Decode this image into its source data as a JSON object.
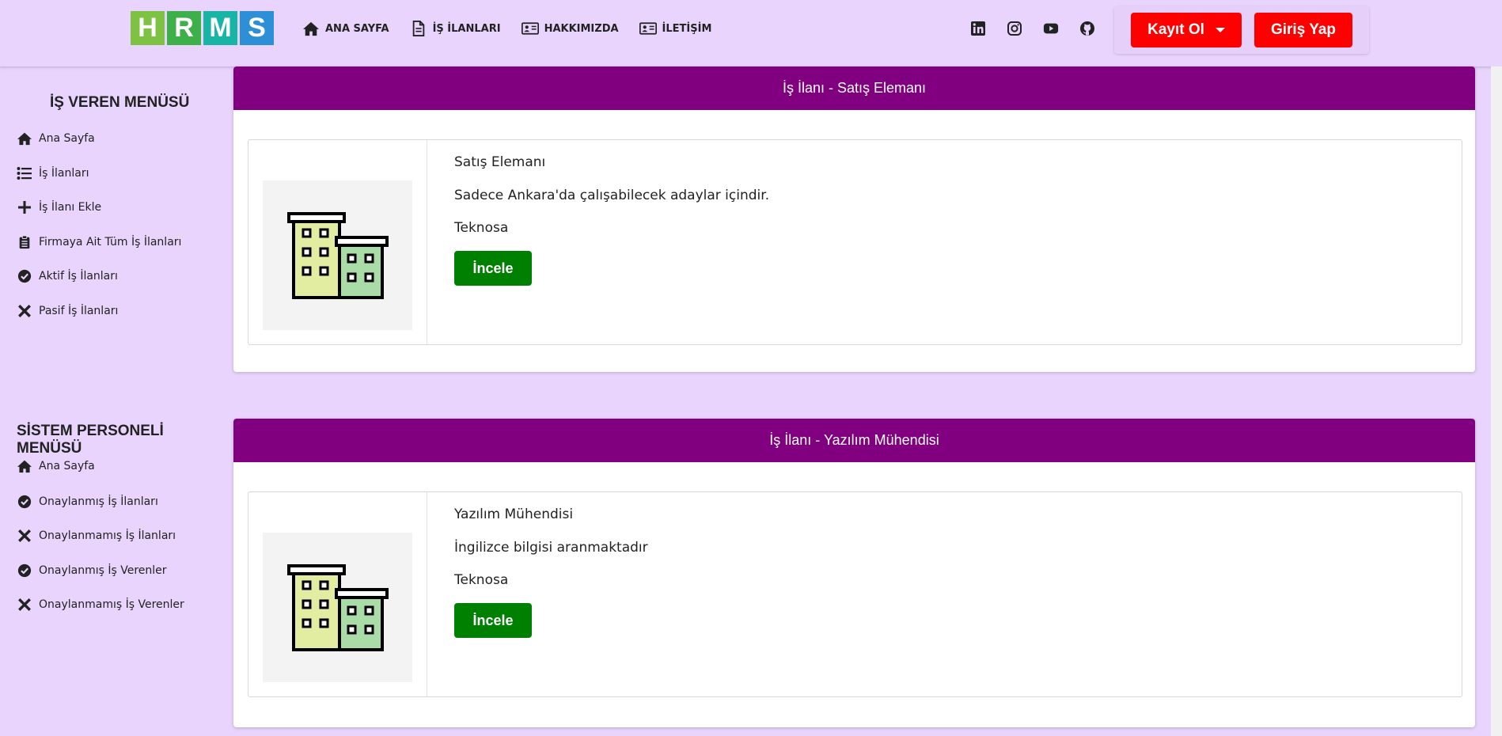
{
  "logo": {
    "letters": [
      "H",
      "R",
      "M",
      "S"
    ],
    "colors": [
      "#7dc242",
      "#3eb049",
      "#18b4a6",
      "#2d8fd5"
    ]
  },
  "nav": [
    {
      "label": "ANA SAYFA",
      "icon": "home-icon"
    },
    {
      "label": "İŞ İLANLARI",
      "icon": "document-icon"
    },
    {
      "label": "HAKKIMIZDA",
      "icon": "id-card-icon"
    },
    {
      "label": "İLETİŞİM",
      "icon": "id-card-icon"
    }
  ],
  "social": [
    "linkedin-icon",
    "instagram-icon",
    "youtube-icon",
    "github-icon"
  ],
  "auth": {
    "register_label": "Kayıt Ol",
    "login_label": "Giriş Yap"
  },
  "employer_menu": {
    "title": "İŞ VEREN MENÜSÜ",
    "items": [
      {
        "label": "Ana Sayfa",
        "icon": "home-icon"
      },
      {
        "label": "İş İlanları",
        "icon": "list-icon"
      },
      {
        "label": "İş İlanı Ekle",
        "icon": "plus-icon"
      },
      {
        "label": "Firmaya Ait Tüm İş İlanları",
        "icon": "clipboard-icon"
      },
      {
        "label": "Aktif İş İlanları",
        "icon": "check-circle-icon"
      },
      {
        "label": "Pasif İş İlanları",
        "icon": "x-icon"
      }
    ]
  },
  "staff_menu": {
    "title": "SİSTEM PERSONELİ MENÜSÜ",
    "items": [
      {
        "label": "Ana Sayfa",
        "icon": "home-icon"
      },
      {
        "label": "Onaylanmış İş İlanları",
        "icon": "check-circle-icon"
      },
      {
        "label": "Onaylanmamış İş İlanları",
        "icon": "x-icon"
      },
      {
        "label": "Onaylanmış İş Verenler",
        "icon": "check-circle-icon"
      },
      {
        "label": "Onaylanmamış İş Verenler",
        "icon": "x-icon"
      }
    ]
  },
  "jobs": [
    {
      "header": "İş İlanı - Satış Elemanı",
      "title": "Satış Elemanı",
      "description": "Sadece Ankara'da çalışabilecek adaylar içindir.",
      "company": "Teknosa",
      "button": "İncele"
    },
    {
      "header": "İş İlanı - Yazılım Mühendisi",
      "title": "Yazılım Mühendisi",
      "description": "İngilizce bilgisi aranmaktadır",
      "company": "Teknosa",
      "button": "İncele"
    }
  ],
  "colors": {
    "header_purple": "#800080",
    "page_bg": "#e8d4fc",
    "button_red": "#ff0000",
    "button_green": "#008000"
  }
}
